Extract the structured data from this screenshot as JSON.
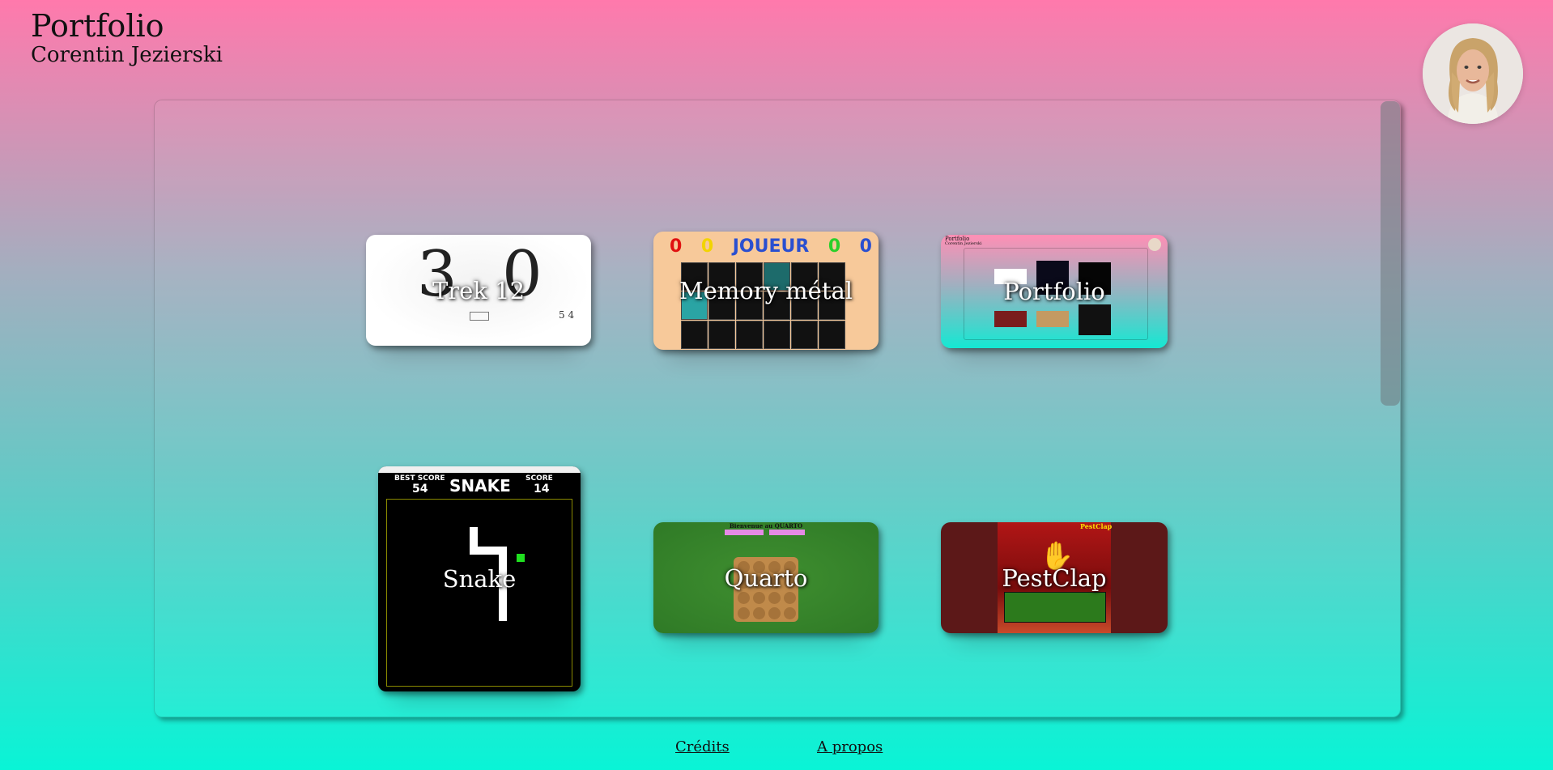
{
  "header": {
    "title": "Portfolio",
    "subtitle": "Corentin Jezierski"
  },
  "projects": [
    {
      "label": "Trek 12",
      "thumb_scores": [
        "3",
        "0"
      ],
      "thumb_small": "5 4"
    },
    {
      "label": "Memory métal",
      "thumb_header": [
        "0",
        "0",
        "JOUEUR",
        "0",
        "0"
      ]
    },
    {
      "label": "Portfolio",
      "thumb_title": "Portfolio",
      "thumb_sub": "Corentin Jezierski"
    },
    {
      "label": "Snake",
      "thumb_best_label": "BEST SCORE",
      "thumb_best": "54",
      "thumb_title": "SNAKE",
      "thumb_score_label": "SCORE",
      "thumb_score": "14"
    },
    {
      "label": "Quarto",
      "thumb_title": "Bienvenue au QUARTO"
    },
    {
      "label": "PestClap",
      "thumb_title": "PestClap"
    }
  ],
  "footer": {
    "credits": "Crédits",
    "about": "A propos"
  },
  "colors": {
    "gradient_top": "#ff79ac",
    "gradient_bottom": "#09f4d6",
    "pestclap_bg": "#5c1818",
    "quarto_green": "#3c8a2f",
    "memory_bg": "#f7c99a"
  }
}
